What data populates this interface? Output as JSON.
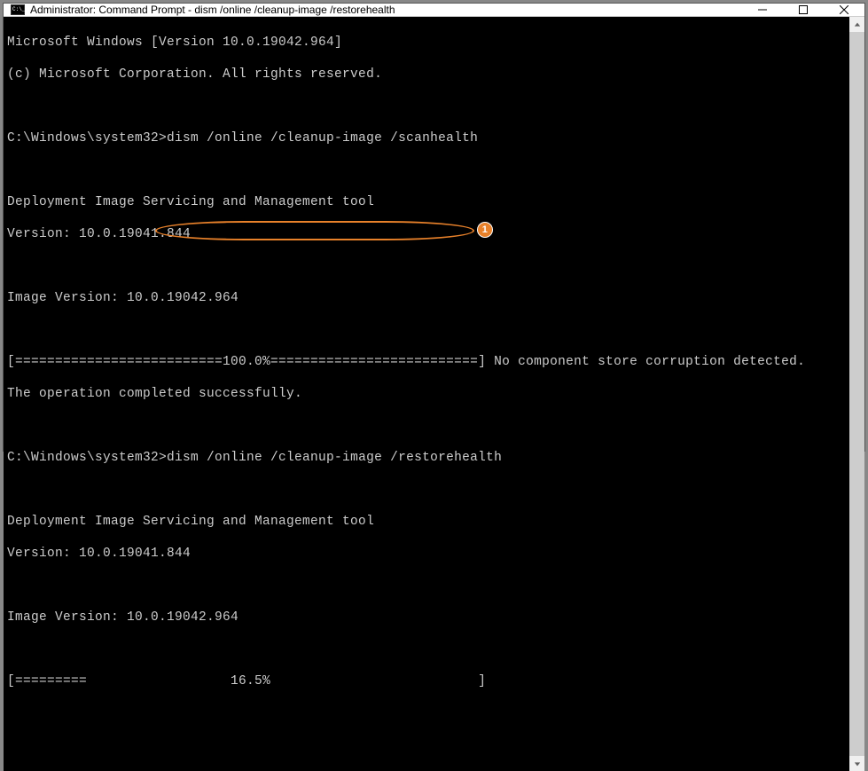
{
  "titlebar": {
    "title": "Administrator: Command Prompt - dism  /online /cleanup-image /restorehealth"
  },
  "terminal": {
    "line1": "Microsoft Windows [Version 10.0.19042.964]",
    "line2": "(c) Microsoft Corporation. All rights reserved.",
    "line3": "",
    "prompt1_path": "C:\\Windows\\system32>",
    "prompt1_cmd": "dism /online /cleanup-image /scanhealth",
    "line5": "",
    "line6": "Deployment Image Servicing and Management tool",
    "line7": "Version: 10.0.19041.844",
    "line8": "",
    "line9": "Image Version: 10.0.19042.964",
    "line10": "",
    "progress1": "[==========================100.0%==========================] No component store corruption detected.",
    "line12": "The operation completed successfully.",
    "line13": "",
    "prompt2_path": "C:\\Windows\\system32>",
    "prompt2_cmd": "dism /online /cleanup-image /restorehealth",
    "line15": "",
    "line16": "Deployment Image Servicing and Management tool",
    "line17": "Version: 10.0.19041.844",
    "line18": "",
    "line19": "Image Version: 10.0.19042.964",
    "line20": "",
    "progress2": "[=========                  16.5%                          ] "
  },
  "annotation": {
    "badge": "1"
  }
}
